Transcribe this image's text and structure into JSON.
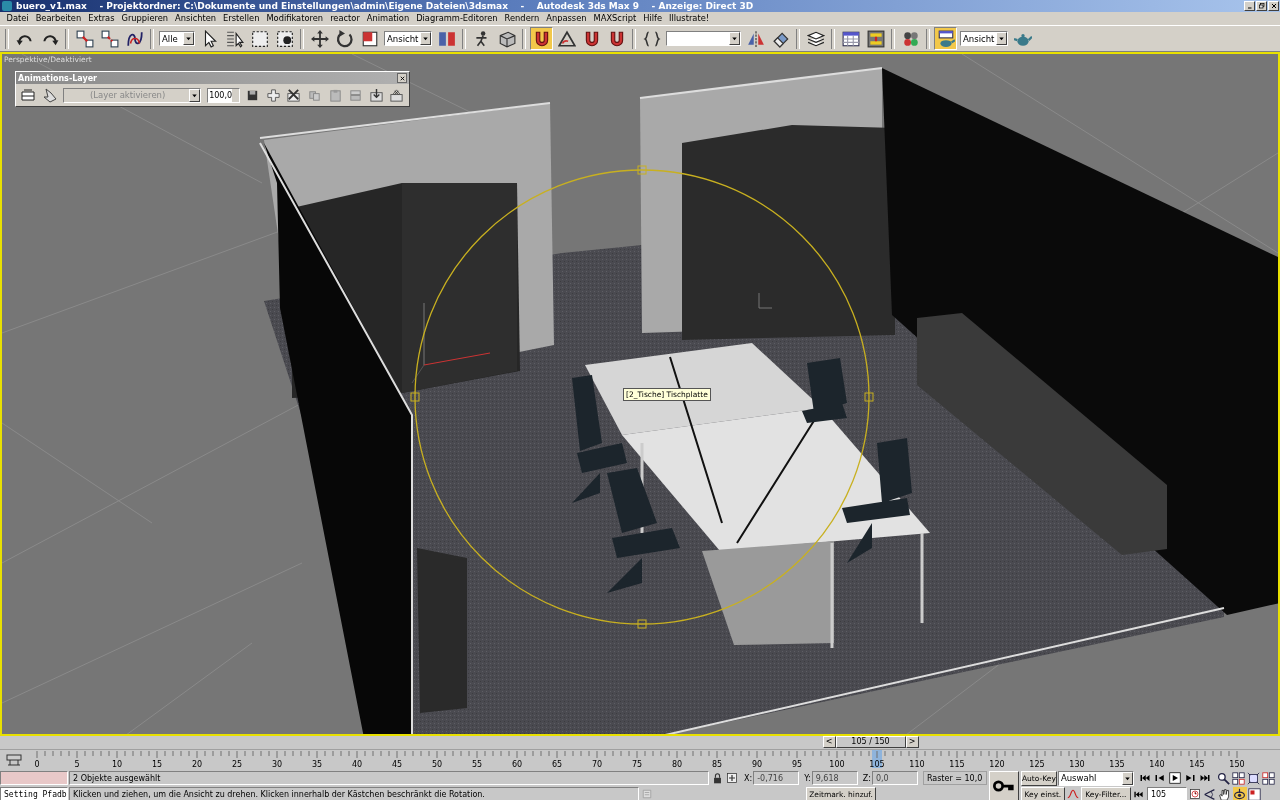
{
  "window": {
    "title": "buero_v1.max    - Projektordner: C:\\Dokumente und Einstellungen\\admin\\Eigene Dateien\\3dsmax    -    Autodesk 3ds Max 9    - Anzeige: Direct 3D"
  },
  "menu": [
    "Datei",
    "Bearbeiten",
    "Extras",
    "Gruppieren",
    "Ansichten",
    "Erstellen",
    "Modifikatoren",
    "reactor",
    "Animation",
    "Diagramm-Editoren",
    "Rendern",
    "Anpassen",
    "MAXScript",
    "Hilfe",
    "Illustrate!"
  ],
  "toolbar": [
    {
      "kind": "separator"
    },
    {
      "kind": "tool",
      "selected": false
    },
    {
      "kind": "tool",
      "selected": false
    },
    {
      "kind": "separator"
    },
    {
      "kind": "tool",
      "selected": false
    },
    {
      "kind": "tool",
      "selected": false
    },
    {
      "kind": "tool",
      "selected": false
    },
    {
      "kind": "separator"
    },
    {
      "kind": "dropdown",
      "value": "Alle"
    },
    {
      "kind": "tool",
      "selected": false
    },
    {
      "kind": "tool",
      "selected": false
    },
    {
      "kind": "tool",
      "selected": false
    },
    {
      "kind": "tool",
      "selected": false
    },
    {
      "kind": "separator"
    },
    {
      "kind": "tool",
      "selected": false
    },
    {
      "kind": "tool",
      "selected": false
    },
    {
      "kind": "tool",
      "selected": false
    },
    {
      "kind": "dropdown",
      "value": "Ansicht"
    },
    {
      "kind": "tool",
      "selected": false
    },
    {
      "kind": "separator"
    },
    {
      "kind": "tool",
      "selected": false
    },
    {
      "kind": "tool",
      "selected": false
    },
    {
      "kind": "separator"
    },
    {
      "kind": "tool",
      "selected": true
    },
    {
      "kind": "tool",
      "selected": false
    },
    {
      "kind": "tool",
      "selected": false
    },
    {
      "kind": "tool",
      "selected": false
    },
    {
      "kind": "separator"
    },
    {
      "kind": "tool",
      "selected": false
    },
    {
      "kind": "dropdown"
    },
    {
      "kind": "tool",
      "selected": false
    },
    {
      "kind": "tool",
      "selected": false
    },
    {
      "kind": "separator"
    },
    {
      "kind": "tool",
      "selected": false
    },
    {
      "kind": "separator"
    },
    {
      "kind": "tool",
      "selected": false
    },
    {
      "kind": "tool",
      "selected": false
    },
    {
      "kind": "separator"
    },
    {
      "kind": "tool",
      "selected": false
    },
    {
      "kind": "separator"
    },
    {
      "kind": "tool",
      "selected": true
    },
    {
      "kind": "dropdown",
      "value": "Ansicht"
    },
    {
      "kind": "tool",
      "selected": false
    }
  ],
  "viewport": {
    "label": "Perspektive/Deaktiviert",
    "tooltip": "[2_Tische] Tischplatte"
  },
  "animation_layer": {
    "title": "Animations-Layer",
    "layer_dropdown": {
      "value": "(Layer aktivieren)",
      "disabled": true
    },
    "weight": "100,0"
  },
  "time_slider": {
    "left": "<",
    "label": "105 / 150",
    "right": ">",
    "level": 0.7
  },
  "ruler": {
    "labels": [
      "0",
      "5",
      "10",
      "15",
      "20",
      "25",
      "30",
      "35",
      "40",
      "45",
      "50",
      "55",
      "60",
      "65",
      "70",
      "75",
      "80",
      "85",
      "90",
      "95",
      "100",
      "105",
      "110",
      "115",
      "120",
      "125",
      "130",
      "135",
      "140",
      "145",
      "150"
    ]
  },
  "status": {
    "selection": "2 Objekte ausgewählt",
    "script_listener": "Setting Pfadb",
    "prompt": "Klicken und ziehen, um die Ansicht zu drehen. Klicken innerhalb der Kästchen beschränkt die Rotation.",
    "coords": [
      {
        "label": "X:",
        "value": "-0,716"
      },
      {
        "label": "Y:",
        "value": "9,618"
      },
      {
        "label": "Z:",
        "value": "0,0"
      }
    ],
    "grid": "Raster = 10,0",
    "add_time_tag": "Zeitmark. hinzuf.",
    "auto_key": {
      "label": "Auto-Key",
      "on": false
    },
    "key_mode": "Auswahl",
    "set_key": "Key einst.",
    "key_filters": "Key-Filter...",
    "frame": "105"
  }
}
